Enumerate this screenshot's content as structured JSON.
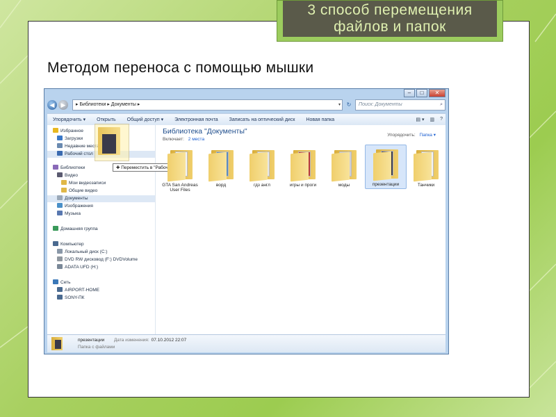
{
  "slide": {
    "title_line1": "3 способ перемещения",
    "title_line2": "файлов  и папок",
    "subtitle": "Методом переноса с помощью мышки"
  },
  "window": {
    "controls": [
      "–",
      "□",
      "✕"
    ],
    "nav": {
      "back": "◀",
      "forward": "▶"
    },
    "address": "▸ Библиотеки ▸ Документы ▸",
    "search_placeholder": "Поиск: Документы",
    "toolbar": [
      "Упорядочить ▾",
      "Открыть",
      "Общий доступ ▾",
      "Электронная почта",
      "Записать на оптический диск",
      "Новая папка"
    ],
    "toolbar_right": [
      "▤ ▾",
      "▥",
      "?"
    ],
    "library_title": "Библиотека \"Документы\"",
    "includes_label": "Включает:",
    "includes_link": "2 места",
    "arrange_label": "Упорядочить:",
    "arrange_value": "Папка ▾",
    "tooltip": "✚ Переместить в \"Рабочий стол\""
  },
  "nav_pane": [
    {
      "label": "Избранное",
      "icon": "star-icon",
      "color": "#e8b820",
      "indent": 0
    },
    {
      "label": "Загрузки",
      "icon": "downloads-icon",
      "color": "#3a78c8",
      "indent": 1
    },
    {
      "label": "Недавние места",
      "icon": "recent-icon",
      "color": "#6a8ab0",
      "indent": 1
    },
    {
      "label": "Рабочий стол",
      "icon": "desktop-icon",
      "color": "#3a6ab0",
      "indent": 1,
      "selected": true
    },
    {
      "label": "Библиотеки",
      "icon": "libraries-icon",
      "color": "#8a6ab8",
      "indent": 0
    },
    {
      "label": "Видео",
      "icon": "video-icon",
      "color": "#5a5a70",
      "indent": 1
    },
    {
      "label": "Мои видеозаписи",
      "icon": "folder-icon",
      "color": "#e0b848",
      "indent": 2
    },
    {
      "label": "Общие видео",
      "icon": "folder-icon",
      "color": "#e0b848",
      "indent": 2
    },
    {
      "label": "Документы",
      "icon": "documents-icon",
      "color": "#9aa8b8",
      "indent": 1,
      "selected": true
    },
    {
      "label": "Изображения",
      "icon": "pictures-icon",
      "color": "#4a90c8",
      "indent": 1
    },
    {
      "label": "Музыка",
      "icon": "music-icon",
      "color": "#5878b0",
      "indent": 1
    },
    {
      "label": "Домашняя группа",
      "icon": "homegroup-icon",
      "color": "#3a9a5a",
      "indent": 0
    },
    {
      "label": "Компьютер",
      "icon": "computer-icon",
      "color": "#4a6a90",
      "indent": 0
    },
    {
      "label": "Локальный диск (C:)",
      "icon": "drive-icon",
      "color": "#8a98a8",
      "indent": 1
    },
    {
      "label": "DVD RW дисковод (F:) DVDVolume",
      "icon": "dvd-icon",
      "color": "#9098a0",
      "indent": 1
    },
    {
      "label": "ADATA UFD (H:)",
      "icon": "usb-icon",
      "color": "#7a8898",
      "indent": 1
    },
    {
      "label": "Сеть",
      "icon": "network-icon",
      "color": "#3a78b8",
      "indent": 0
    },
    {
      "label": "AIRPORT-HOME",
      "icon": "pc-icon",
      "color": "#4a6a90",
      "indent": 1
    },
    {
      "label": "SONY-ПК",
      "icon": "pc-icon",
      "color": "#4a6a90",
      "indent": 1
    }
  ],
  "folders": [
    {
      "name": "GTA San Andreas User Files",
      "thumb": "#f4f4f4"
    },
    {
      "name": "ворд",
      "thumb": "#5a8ac0"
    },
    {
      "name": "гдз англ",
      "thumb": "#e8e8e8"
    },
    {
      "name": "игры и проги",
      "thumb": "#b83a3a"
    },
    {
      "name": "моды",
      "thumb": "#d0d0d8"
    },
    {
      "name": "презентации",
      "thumb": "#3a3a4a",
      "selected": true
    },
    {
      "name": "Танчики",
      "thumb": "#f4f4f4"
    }
  ],
  "details": {
    "name": "презентации",
    "modified_label": "Дата изменения:",
    "modified_value": "07.10.2012 22:07",
    "type": "Папка с файлами"
  }
}
